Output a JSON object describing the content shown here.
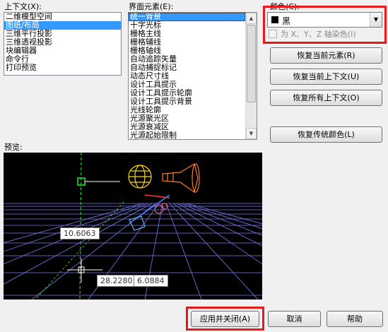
{
  "context": {
    "label": "上下文(X):",
    "items": [
      "二维模型空间",
      "图纸/布局",
      "三维平行投影",
      "三维透视投影",
      "块编辑器",
      "命令行",
      "打印预览"
    ],
    "selected_index": 1
  },
  "elements": {
    "label": "界面元素(E):",
    "items": [
      "统一背景",
      "十字光标",
      "栅格主线",
      "栅格辅线",
      "栅格轴线",
      "自动追踪矢量",
      "自动捕捉标记",
      "动态尺寸线",
      "设计工具提示",
      "设计工具提示轮廓",
      "设计工具提示背景",
      "光线轮廓",
      "光源聚光区",
      "光源衰减区",
      "光源起始限制"
    ],
    "selected_index": 0
  },
  "color": {
    "label": "颜色(C):",
    "value": "黑",
    "swatch": "#000000",
    "tint_label": "为 X、Y、Z 轴染色(I)",
    "tint_checked": false
  },
  "buttons": {
    "restore_element": "恢复当前元素(R)",
    "restore_context": "恢复当前上下文(U)",
    "restore_all": "恢复所有上下文(O)",
    "restore_classic": "恢复传统颜色(L)",
    "apply_close": "应用并关闭(A)",
    "cancel": "取消",
    "help": "帮助"
  },
  "preview": {
    "label": "预览:",
    "coord1": "10.6063",
    "coord2": "28.2280",
    "coord3": "6.0884"
  },
  "colors": {
    "highlight": "#3399ff",
    "annotation": "#e8191b",
    "grid": "#8888ff"
  }
}
